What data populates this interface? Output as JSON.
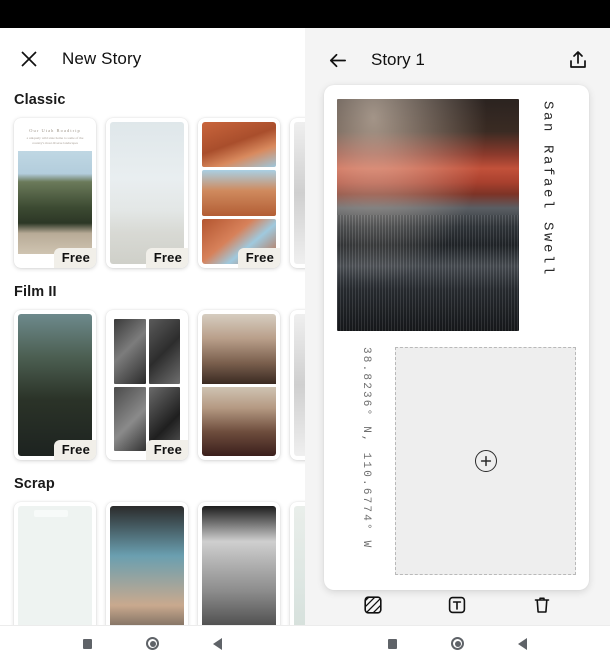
{
  "left_panel": {
    "close_icon": "close-icon",
    "title": "New Story",
    "sections": [
      {
        "title": "Classic",
        "cards": [
          {
            "name": "classic-template-1",
            "badge": "Free",
            "header_title": "Our Utah Roadtrip",
            "header_subtitle": "a uniquely wild state home to some of the country's most diverse landscapes"
          },
          {
            "name": "classic-template-2",
            "badge": "Free"
          },
          {
            "name": "classic-template-3",
            "badge": "Free"
          },
          {
            "name": "classic-template-4",
            "badge": ""
          }
        ]
      },
      {
        "title": "Film II",
        "cards": [
          {
            "name": "film2-template-1",
            "badge": "Free"
          },
          {
            "name": "film2-template-2",
            "badge": "Free"
          },
          {
            "name": "film2-template-3",
            "badge": ""
          },
          {
            "name": "film2-template-4",
            "badge": ""
          }
        ]
      },
      {
        "title": "Scrap",
        "cards": [
          {
            "name": "scrap-template-1",
            "badge": ""
          },
          {
            "name": "scrap-template-2",
            "badge": ""
          },
          {
            "name": "scrap-template-3",
            "badge": ""
          },
          {
            "name": "scrap-template-4",
            "badge": ""
          }
        ]
      }
    ]
  },
  "right_panel": {
    "back_icon": "arrow-left-icon",
    "title": "Story 1",
    "upload_icon": "upload-icon",
    "story": {
      "place_label": "San Rafael Swell",
      "coordinates": "38.8236° N, 110.6774° W",
      "add_photo_icon": "plus-circle-icon"
    },
    "toolbar": [
      {
        "name": "image-tool-button",
        "icon": "hatched-square-icon"
      },
      {
        "name": "text-tool-button",
        "icon": "text-box-icon"
      },
      {
        "name": "delete-tool-button",
        "icon": "trash-icon"
      }
    ]
  },
  "nav_bar": {
    "recents": "recents-square-icon",
    "home": "home-circle-icon",
    "back": "back-triangle-icon"
  },
  "colors": {
    "panel_bg": "#f4f4f4",
    "card_bg": "#ffffff",
    "text_primary": "#111111",
    "text_muted": "#6d6d6d",
    "badge_bg": "#f1efe9",
    "placeholder_bg": "#eeeeee",
    "dashed_border": "#b9b9b9"
  }
}
